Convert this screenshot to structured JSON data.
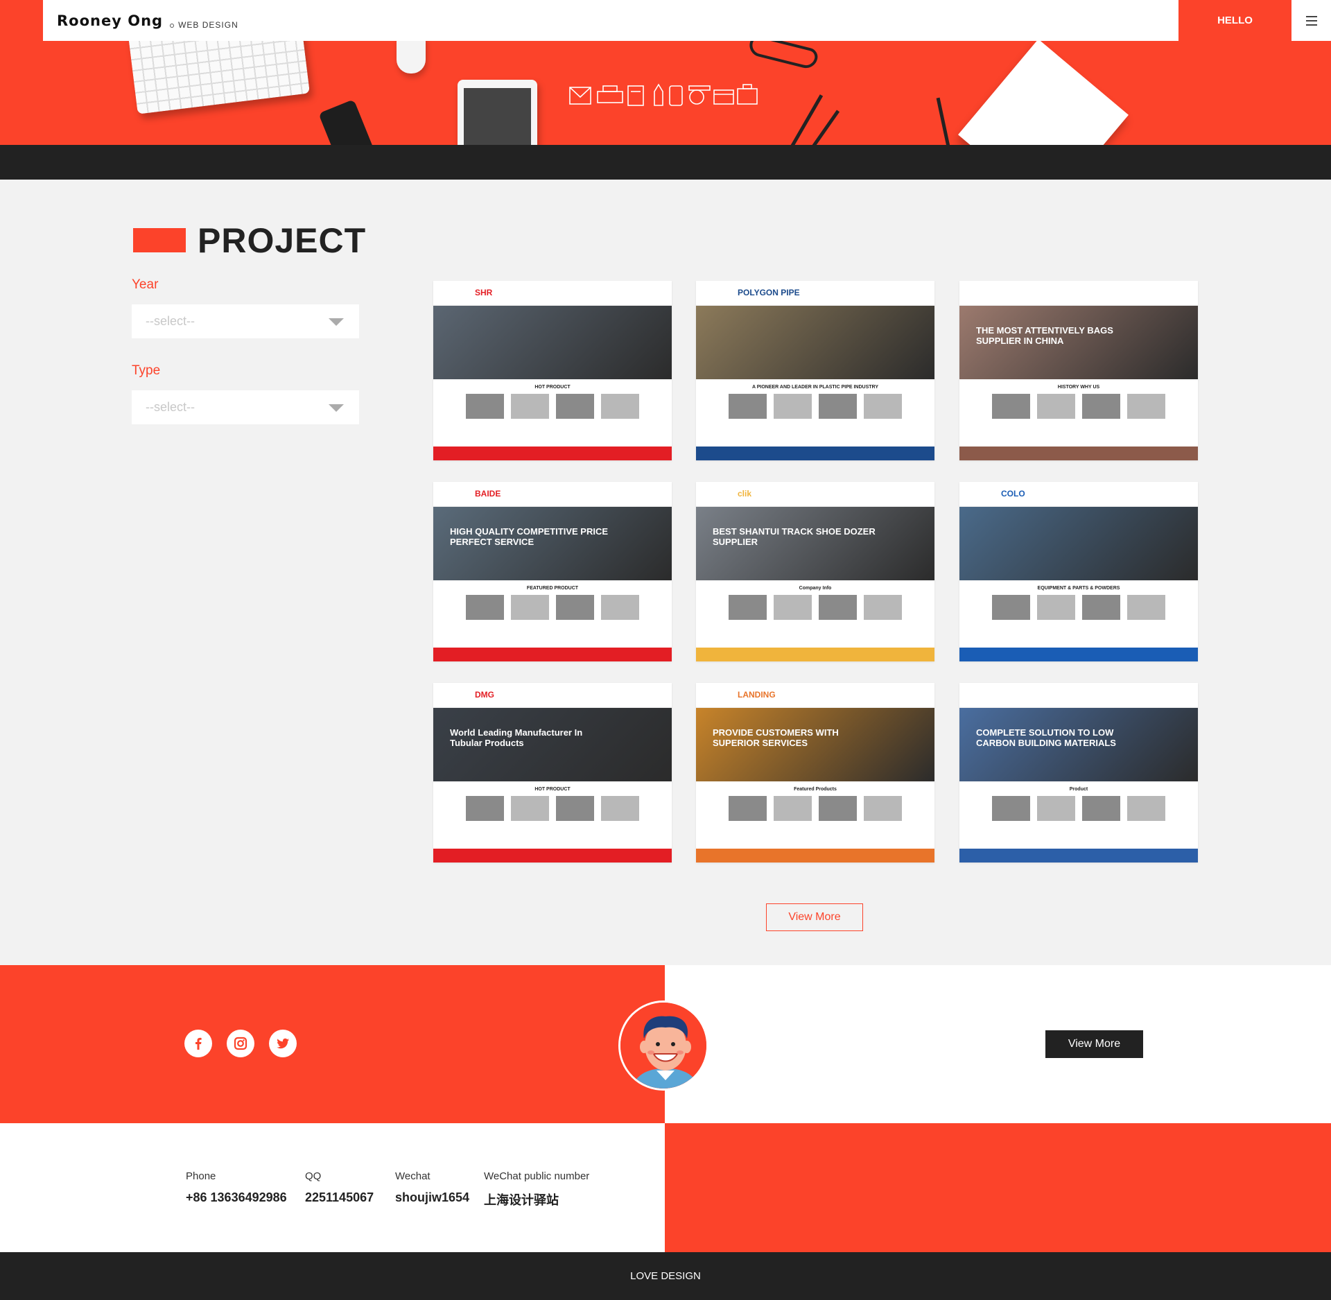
{
  "header": {
    "brand_name": "Rooney Ong",
    "brand_sub": "WEB DESIGN",
    "hello_label": "HELLO"
  },
  "project": {
    "title": "PROJECT",
    "year_label": "Year",
    "year_select": "--select--",
    "type_label": "Type",
    "type_select": "--select--",
    "view_more": "View More",
    "cards": [
      {
        "logo": "SHR",
        "banner": "",
        "strip": "HOT PRODUCT",
        "accent": "#e31e24",
        "banner_color": "#5b6672"
      },
      {
        "logo": "POLYGON PIPE",
        "banner": "",
        "strip": "A PIONEER AND LEADER IN PLASTIC PIPE INDUSTRY",
        "accent": "#1c4b8c",
        "banner_color": "#8c7a5a"
      },
      {
        "logo": "",
        "banner": "THE MOST ATTENTIVELY BAGS SUPPLIER IN CHINA",
        "strip": "HISTORY    WHY US",
        "accent": "#8c5a4a",
        "banner_color": "#9c7a6e"
      },
      {
        "logo": "BAIDE",
        "banner": "HIGH QUALITY COMPETITIVE PRICE PERFECT SERVICE",
        "strip": "FEATURED PRODUCT",
        "accent": "#e31e24",
        "banner_color": "#5a6b7a"
      },
      {
        "logo": "clik",
        "banner": "BEST SHANTUI TRACK SHOE DOZER SUPPLIER",
        "strip": "Company Info",
        "accent": "#f0b43c",
        "banner_color": "#7a8088"
      },
      {
        "logo": "COLO",
        "banner": "",
        "strip": "EQUIPMENT & PARTS & POWDERS",
        "accent": "#1a5db5",
        "banner_color": "#4a6a8a"
      },
      {
        "logo": "DMG",
        "banner": "World Leading Manufacturer In Tubular Products",
        "strip": "HOT PRODUCT",
        "accent": "#e31e24",
        "banner_color": "#3a4048"
      },
      {
        "logo": "LANDING",
        "banner": "PROVIDE CUSTOMERS WITH SUPERIOR SERVICES",
        "strip": "Featured Products",
        "accent": "#e8742a",
        "banner_color": "#c8842a"
      },
      {
        "logo": "",
        "banner": "COMPLETE SOLUTION TO LOW CARBON BUILDING MATERIALS",
        "strip": "Product",
        "accent": "#2c5fa8",
        "banner_color": "#4a6ea0"
      }
    ]
  },
  "contact": {
    "view_more": "View More",
    "social": [
      "facebook-icon",
      "instagram-icon",
      "twitter-icon"
    ],
    "info": [
      {
        "label": "Phone",
        "value": "+86 13636492986"
      },
      {
        "label": "QQ",
        "value": "2251145067"
      },
      {
        "label": "Wechat",
        "value": "shoujiw1654"
      },
      {
        "label": "WeChat public number",
        "value": "上海设计驿站"
      }
    ]
  },
  "footer": {
    "text": "LOVE DESIGN"
  },
  "colors": {
    "accent": "#fc432a",
    "dark": "#222222",
    "light_bg": "#f2f2f2"
  }
}
